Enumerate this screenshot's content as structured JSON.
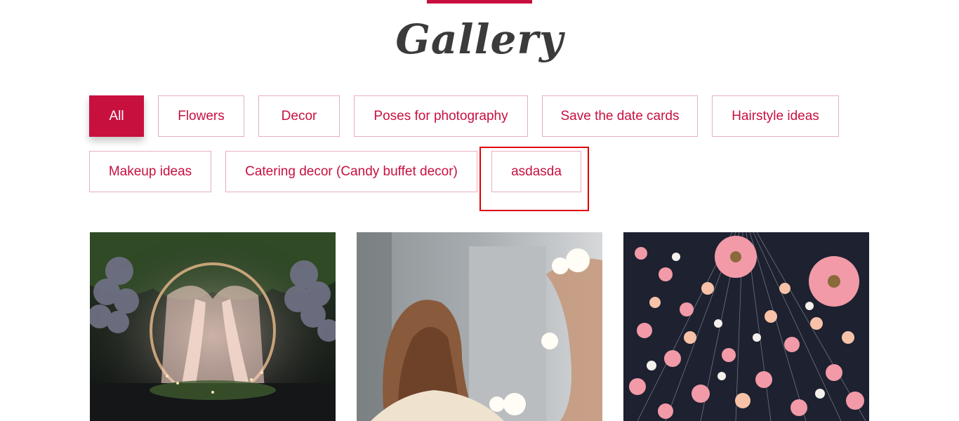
{
  "section": {
    "title": "Gallery",
    "accent_color": "#c8103f"
  },
  "filters": [
    {
      "label": "All",
      "active": true
    },
    {
      "label": "Flowers",
      "active": false
    },
    {
      "label": "Decor",
      "active": false
    },
    {
      "label": "Poses for photography",
      "active": false
    },
    {
      "label": "Save the date cards",
      "active": false
    },
    {
      "label": "Hairstyle ideas",
      "active": false
    },
    {
      "label": "Makeup ideas",
      "active": false
    },
    {
      "label": "Catering decor (Candy buffet decor)",
      "active": false
    },
    {
      "label": "asdasda",
      "active": false
    }
  ],
  "gallery": [
    {
      "subject": "wedding arch with balloons"
    },
    {
      "subject": "woman at makeup mirror"
    },
    {
      "subject": "hanging flower installation"
    }
  ]
}
